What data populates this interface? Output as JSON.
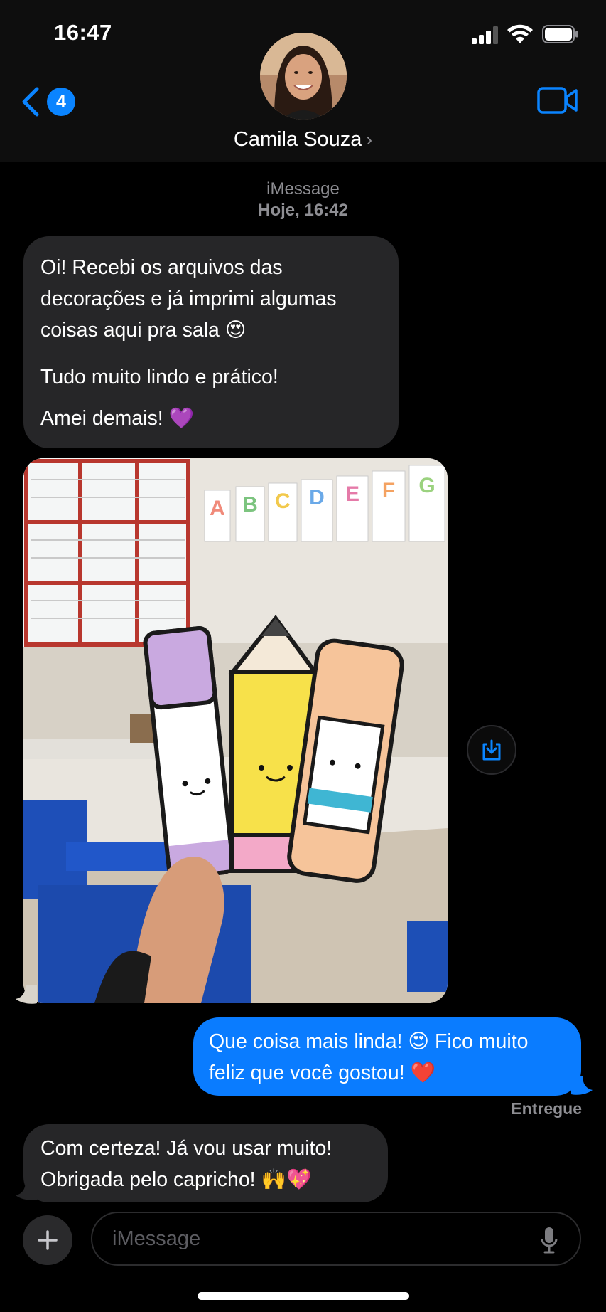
{
  "status_bar": {
    "time": "16:47"
  },
  "header": {
    "back_badge_count": "4",
    "contact_name": "Camila Souza",
    "name_chevron": "›"
  },
  "conversation": {
    "service_label": "iMessage",
    "date_label": "Hoje, 16:42",
    "messages": [
      {
        "id": "m1",
        "direction": "incoming",
        "paragraphs": [
          "Oi! Recebi os arquivos das decorações e já imprimi algumas coisas aqui pra sala 😍",
          "Tudo muito lindo e prático!",
          "Amei demais! 💜"
        ]
      },
      {
        "id": "m2",
        "direction": "incoming",
        "type": "image"
      },
      {
        "id": "m3",
        "direction": "outgoing",
        "text": "Que coisa mais linda! 😍 Fico muito feliz que você gostou! ❤️"
      },
      {
        "id": "m4",
        "direction": "incoming",
        "text": "Com certeza! Já vou usar muito! Obrigada pelo capricho! 🙌💖"
      }
    ],
    "delivery_status": "Entregue"
  },
  "photo": {
    "alphabet_cards": [
      "A",
      "B",
      "C",
      "D",
      "E",
      "F",
      "G"
    ],
    "card_colors": [
      "#f08a7a",
      "#7cc47f",
      "#f2c94c",
      "#6aa9e8",
      "#e57aa8",
      "#f4a261",
      "#9bd27f"
    ]
  },
  "input_bar": {
    "placeholder": "iMessage"
  },
  "colors": {
    "accent": "#0a84ff",
    "outgoing_bubble": "#0a7cff",
    "incoming_bubble": "#262628"
  },
  "icons": [
    "back-chevron-icon",
    "video-camera-icon",
    "plus-icon",
    "microphone-icon",
    "save-download-icon",
    "cellular-signal-icon",
    "wifi-icon",
    "battery-icon"
  ]
}
